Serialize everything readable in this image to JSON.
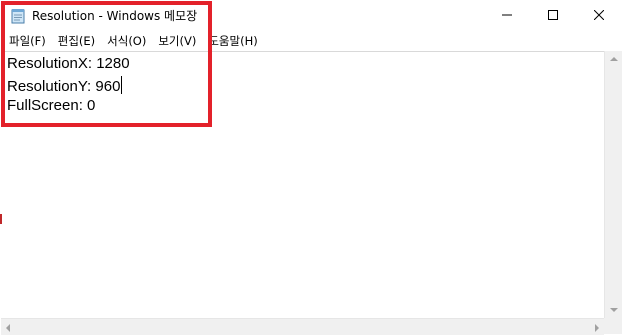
{
  "window": {
    "title": "Resolution - Windows 메모장",
    "controls": {
      "minimize": "—",
      "maximize": "☐",
      "close": "✕"
    }
  },
  "menu": {
    "items": [
      {
        "label": "파일(F)"
      },
      {
        "label": "편집(E)"
      },
      {
        "label": "서식(O)"
      },
      {
        "label": "보기(V)"
      },
      {
        "label": "도움말(H)"
      }
    ]
  },
  "editor": {
    "lines": [
      "ResolutionX: 1280",
      "ResolutionY: 960",
      "FullScreen: 0"
    ]
  },
  "annotation": {
    "highlight_color": "#e3212a"
  },
  "icons": {
    "app": "notepad-icon",
    "minimize": "minimize-icon",
    "maximize": "maximize-icon",
    "close": "close-icon"
  }
}
